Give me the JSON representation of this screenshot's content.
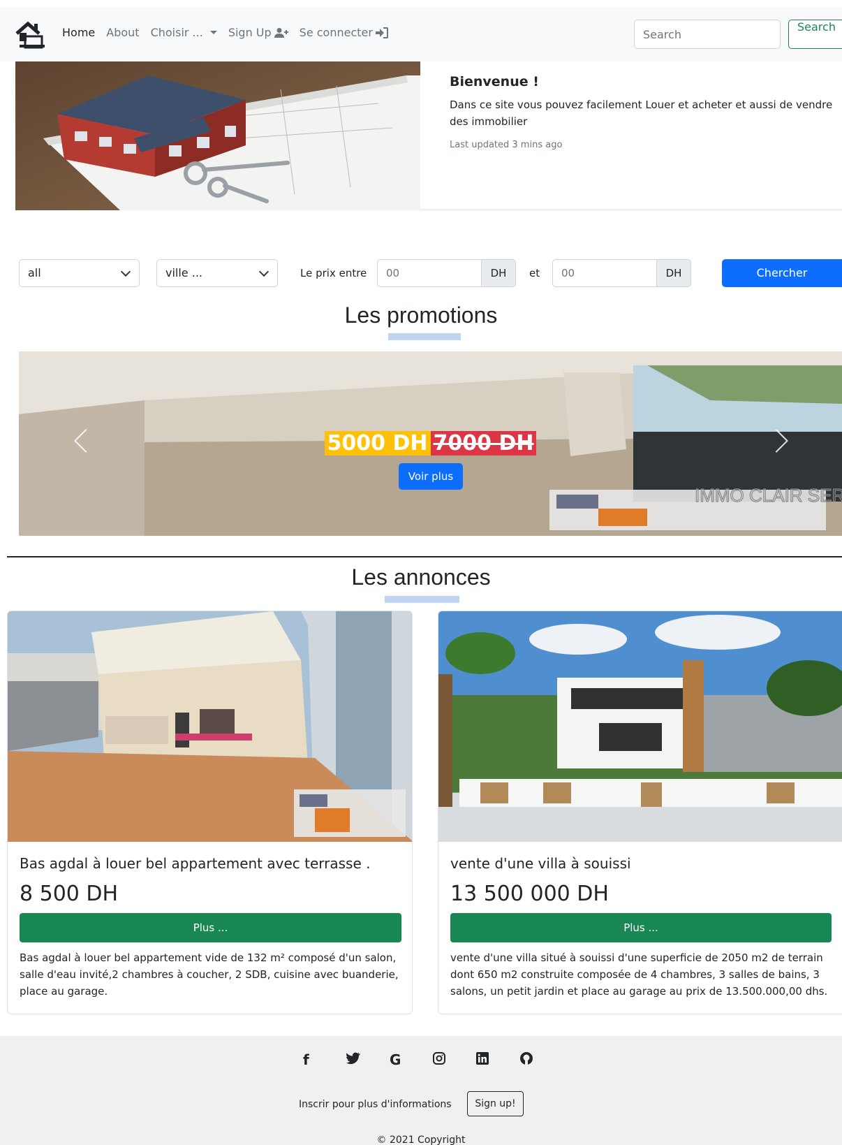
{
  "navbar": {
    "links": [
      "Home",
      "About",
      "Choisir ...",
      "Sign Up",
      "Se connecter"
    ],
    "search_placeholder": "Search",
    "search_button": "Search"
  },
  "hero": {
    "title": "Bienvenue !",
    "text": "Dans ce site vous pouvez facilement Louer et acheter et aussi de vendre des immobilier",
    "updated": "Last updated 3 mins ago"
  },
  "filters": {
    "type_select": "all",
    "city_select": "ville ...",
    "price_label": "Le prix entre",
    "min_placeholder": "00",
    "max_placeholder": "00",
    "currency": "DH",
    "and_label": "et",
    "submit": "Chercher"
  },
  "promotions": {
    "title": "Les promotions",
    "new_price": "5000 DH",
    "old_price": "7000 DH",
    "button": "Voir plus",
    "watermark": "IMMO CLAIR SERVICE"
  },
  "annonces": {
    "title": "Les annonces",
    "items": [
      {
        "title": "Bas agdal à louer bel appartement avec terrasse .",
        "price": "8 500 DH",
        "button": "Plus ...",
        "description": "Bas agdal à louer bel appartement vide de 132 m² composé d'un salon, salle d'eau invité,2 chambres à coucher, 2 SDB, cuisine avec buanderie, place au garage."
      },
      {
        "title": "vente d'une villa à souissi",
        "price": "13 500 000 DH",
        "button": "Plus ...",
        "description": "vente d'une villa situé à souissi d'une superficie de 2050 m2 de terrain dont 650 m2 construite composée de 4 chambres, 3 salles de bains, 3 salons, un petit jardin et place au garage au prix de 13.500.000,00 dhs."
      }
    ]
  },
  "footer": {
    "social_icons": [
      "facebook-icon",
      "twitter-icon",
      "google-icon",
      "instagram-icon",
      "linkedin-icon",
      "github-icon"
    ],
    "text": "Inscrir pour plus d'informations",
    "signup": "Sign up!",
    "copyright": "© 2021 Copyright"
  },
  "colors": {
    "primary": "#0d6efd",
    "success": "#198754",
    "warning": "#ffc107",
    "danger": "#dc3545"
  }
}
